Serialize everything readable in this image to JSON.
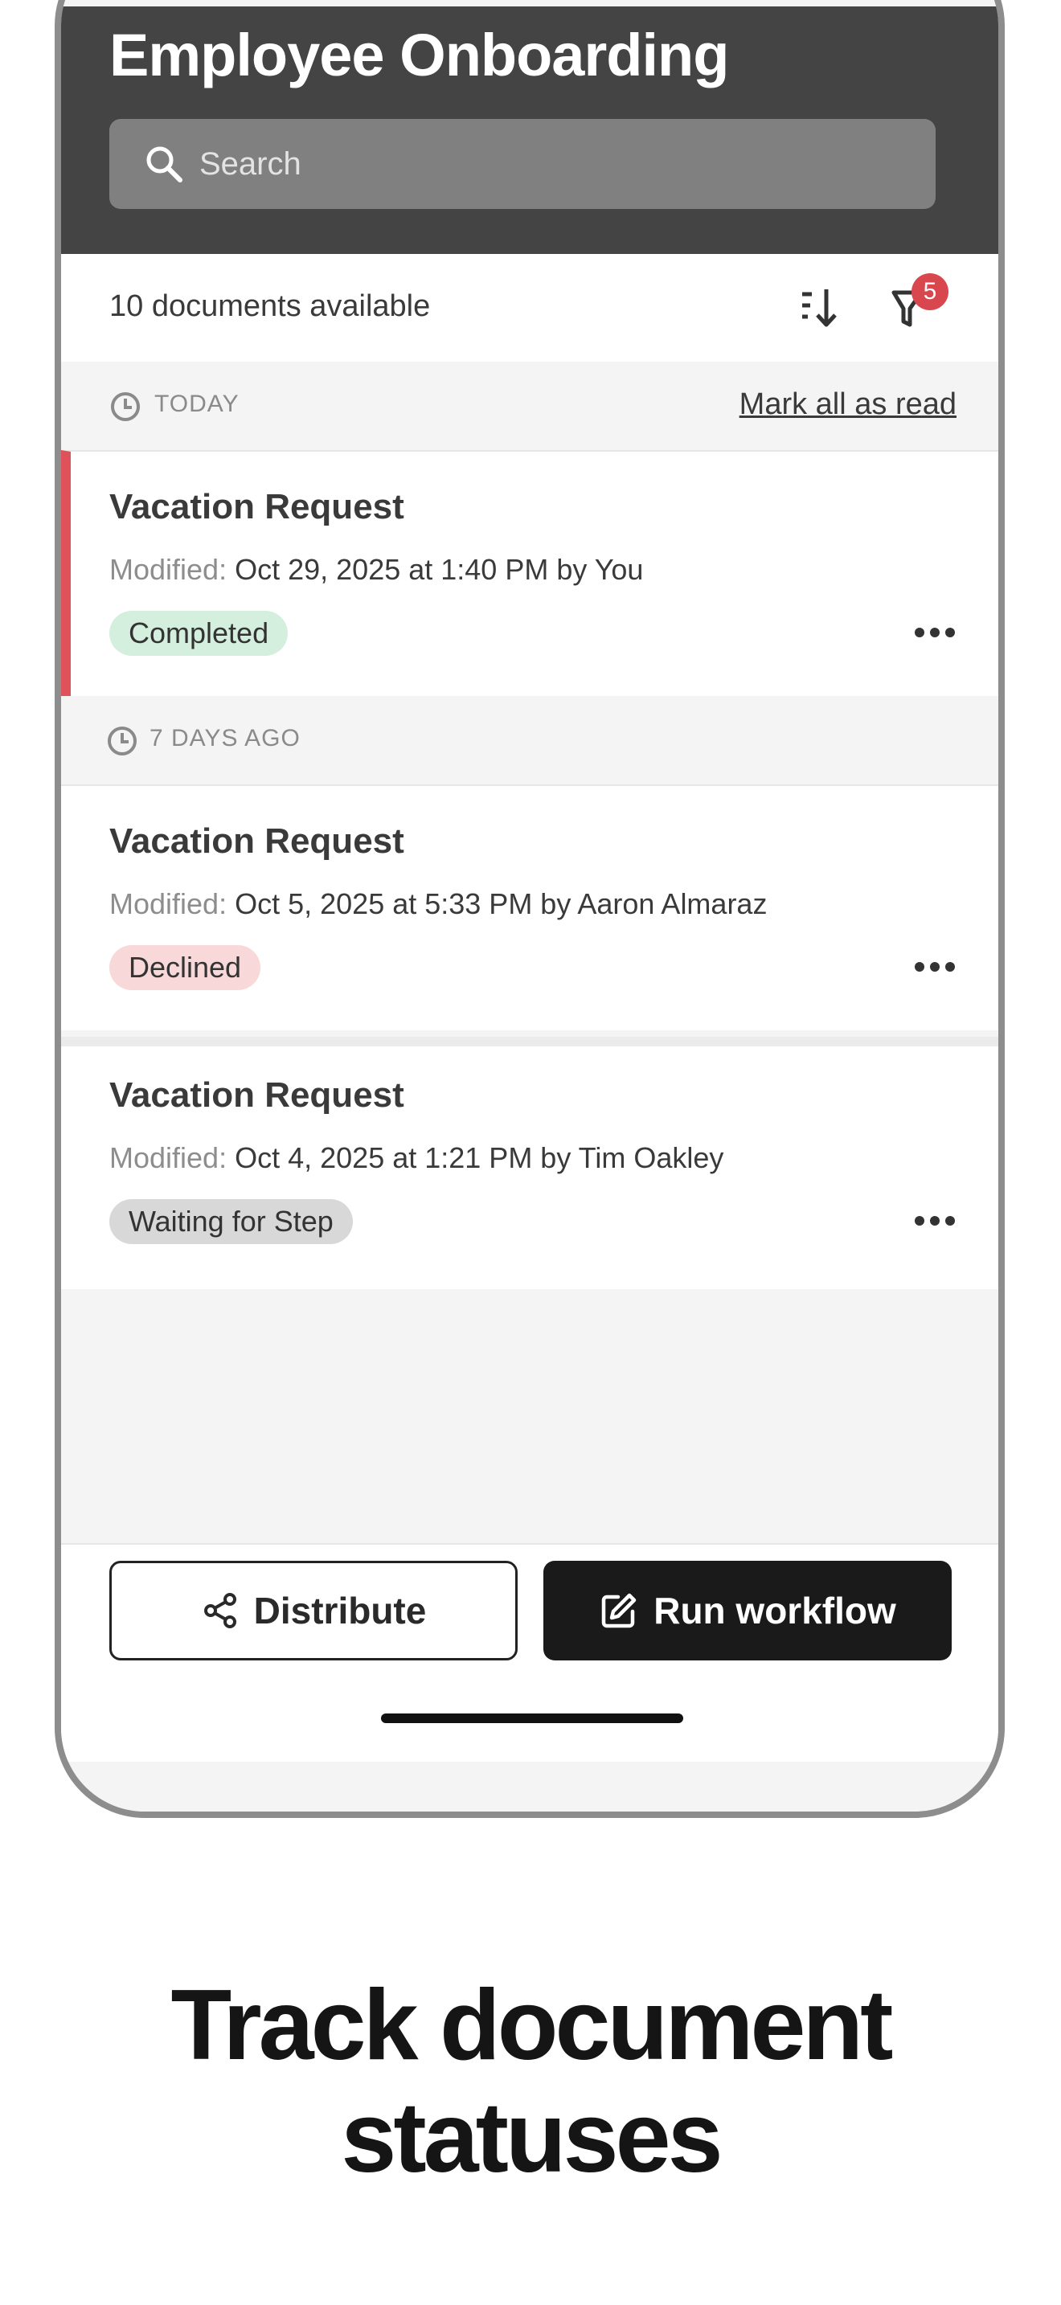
{
  "header": {
    "title": "Employee Onboarding",
    "search_placeholder": "Search"
  },
  "toolbar": {
    "count_text": "10 documents available",
    "filter_badge": "5",
    "sort_icon": "sort-icon",
    "filter_icon": "filter-icon"
  },
  "sections": [
    {
      "label": "TODAY",
      "action": "Mark all as read"
    },
    {
      "label": "7 DAYS AGO"
    }
  ],
  "documents": [
    {
      "title": "Vacation Request",
      "meta_label": "Modified:",
      "meta_value": "Oct 29, 2025 at 1:40 PM by You",
      "status": "Completed",
      "status_color": "#d4efde"
    },
    {
      "title": "Vacation Request",
      "meta_label": "Modified:",
      "meta_value": "Oct 5, 2025 at 5:33 PM by Aaron Almaraz",
      "status": "Declined",
      "status_color": "#f8d8d8"
    },
    {
      "title": "Vacation Request",
      "meta_label": "Modified:",
      "meta_value": "Oct 4, 2025 at 1:21 PM by Tim Oakley",
      "status": "Waiting for Step",
      "status_color": "#d8d8d8"
    }
  ],
  "actions": {
    "distribute": "Distribute",
    "run_workflow": "Run workflow"
  },
  "tagline": {
    "line1": "Track document",
    "line2": "statuses"
  },
  "colors": {
    "header_bg": "#444444",
    "accent_red": "#e05259",
    "badge_red": "#d9474e"
  }
}
